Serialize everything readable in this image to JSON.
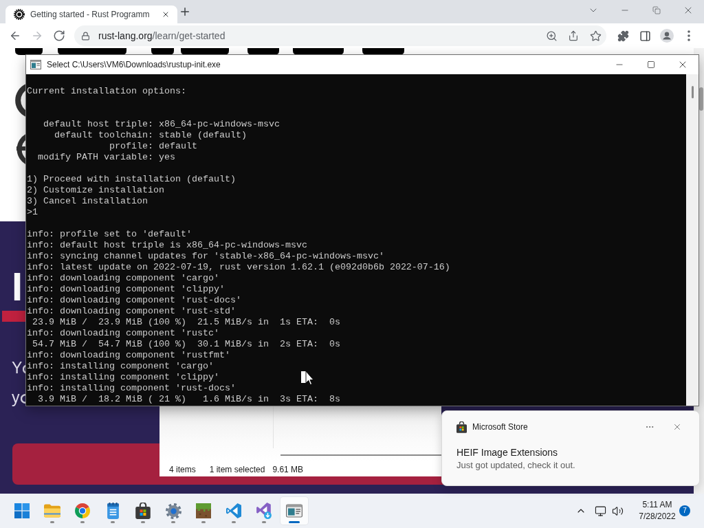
{
  "browser": {
    "tabs": [
      {
        "title": "Getting started - Rust Programm",
        "selected": true
      }
    ],
    "nav": [
      {
        "kind": "back",
        "disabled": false
      },
      {
        "kind": "forward",
        "disabled": true
      },
      {
        "kind": "reload",
        "disabled": false
      }
    ],
    "address": {
      "host": "rust-lang.org",
      "path": "/learn/get-started"
    }
  },
  "page": {
    "install_heading": "I",
    "install_lines": [
      "Y",
      "y"
    ]
  },
  "console": {
    "title": "Select C:\\Users\\VM6\\Downloads\\rustup-init.exe",
    "blocks": [
      {
        "kind": "heading",
        "lines": [
          "Current installation options:"
        ]
      },
      {
        "kind": "settings",
        "lines": [
          "   default host triple: x86_64-pc-windows-msvc",
          "     default toolchain: stable (default)",
          "               profile: default",
          "  modify PATH variable: yes"
        ]
      },
      {
        "kind": "menu",
        "lines": [
          "1) Proceed with installation (default)",
          "2) Customize installation",
          "3) Cancel installation",
          ">1"
        ]
      },
      {
        "kind": "log",
        "lines": [
          "info: profile set to 'default'",
          "info: default host triple is x86_64-pc-windows-msvc",
          "info: syncing channel updates for 'stable-x86_64-pc-windows-msvc'",
          "info: latest update on 2022-07-19, rust version 1.62.1 (e092d0b6b 2022-07-16)",
          "info: downloading component 'cargo'",
          "info: downloading component 'clippy'",
          "info: downloading component 'rust-docs'",
          "info: downloading component 'rust-std'",
          " 23.9 MiB /  23.9 MiB (100 %)  21.5 MiB/s in  1s ETA:  0s",
          "info: downloading component 'rustc'",
          " 54.7 MiB /  54.7 MiB (100 %)  30.1 MiB/s in  2s ETA:  0s",
          "info: downloading component 'rustfmt'",
          "info: installing component 'cargo'",
          "info: installing component 'clippy'",
          "info: installing component 'rust-docs'",
          "  3.9 MiB /  18.2 MiB ( 21 %)   1.6 MiB/s in  3s ETA:  8s"
        ]
      }
    ]
  },
  "explorer": {
    "item_count": "4 items",
    "selection": "1 item selected",
    "size": "9.61 MB"
  },
  "toast": {
    "app": "Microsoft Store",
    "title": "HEIF Image Extensions",
    "body": "Just got updated, check it out."
  },
  "taskbar": {
    "apps": [
      {
        "kind": "file-explorer",
        "running": true,
        "active": false
      },
      {
        "kind": "browser",
        "running": true,
        "active": false
      },
      {
        "kind": "notepad",
        "running": true,
        "active": false
      },
      {
        "kind": "store",
        "running": true,
        "active": false
      },
      {
        "kind": "settings",
        "running": true,
        "active": false
      },
      {
        "kind": "game",
        "running": true,
        "active": false
      },
      {
        "kind": "code-editor",
        "running": true,
        "active": false
      },
      {
        "kind": "installer",
        "running": true,
        "active": false
      },
      {
        "kind": "terminal",
        "running": true,
        "active": true
      }
    ],
    "clock": {
      "time": "5:11 AM",
      "date": "7/28/2022"
    },
    "notification_count": "7"
  }
}
